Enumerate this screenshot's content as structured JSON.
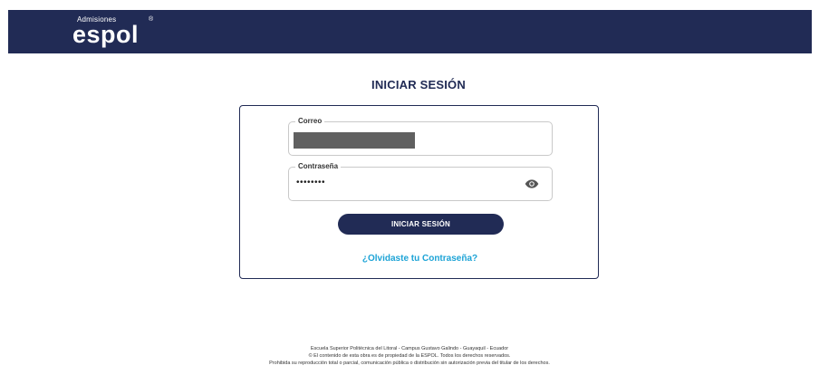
{
  "header": {
    "logo_small": "Admisiones",
    "logo_main": "espol",
    "logo_registered": "®",
    "background_color": "#212b55"
  },
  "login": {
    "title": "INICIAR SESIÓN",
    "email_label": "Correo",
    "email_value_state": "redacted",
    "password_label": "Contraseña",
    "password_value": "••••••••",
    "password_toggle_icon": "eye-icon",
    "button_label": "INICIAR SESIÓN",
    "forgot_link": "¿Olvidaste tu Contraseña?",
    "primary_color": "#212b55",
    "link_color": "#1ca3d6"
  },
  "footer": {
    "line1": "Escuela Superior Politécnica del Litoral - Campus Gustavo Galindo - Guayaquil - Ecuador",
    "line2": "© El contenido de esta obra es de propiedad de la ESPOL. Todos los derechos reservados.",
    "line3": "Prohibida su reproducción total o parcial, comunicación pública o distribución sin autorización previa del titular de los derechos."
  }
}
